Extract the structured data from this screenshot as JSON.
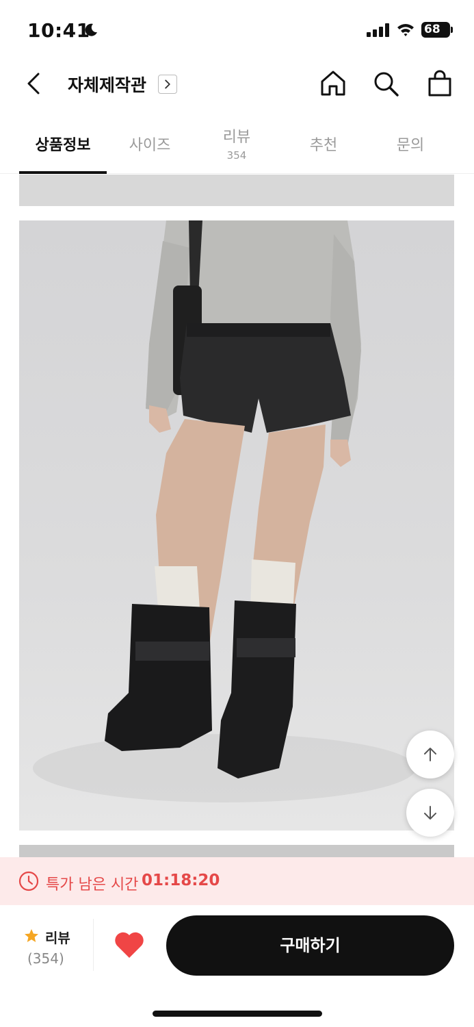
{
  "status_bar": {
    "time": "10:41",
    "battery": "68"
  },
  "header": {
    "brand_title": "자체제작관"
  },
  "tabs": [
    {
      "label": "상품정보",
      "count": ""
    },
    {
      "label": "사이즈",
      "count": ""
    },
    {
      "label": "리뷰",
      "count": "354"
    },
    {
      "label": "추천",
      "count": ""
    },
    {
      "label": "문의",
      "count": ""
    }
  ],
  "timer": {
    "label": "특가 남은 시간",
    "value": "01:18:20"
  },
  "bottom": {
    "review_label": "리뷰",
    "review_count": "(354)",
    "buy_label": "구매하기"
  },
  "colors": {
    "accent": "#e54848",
    "banner_bg": "#fdeaea",
    "star": "#f5a623",
    "heart": "#f04545",
    "buy_bg": "#111111"
  },
  "icons": [
    "back-icon",
    "chevron-right-icon",
    "home-icon",
    "search-icon",
    "shopping-bag-icon",
    "arrow-up-icon",
    "arrow-down-icon",
    "clock-icon",
    "star-icon",
    "heart-icon"
  ]
}
